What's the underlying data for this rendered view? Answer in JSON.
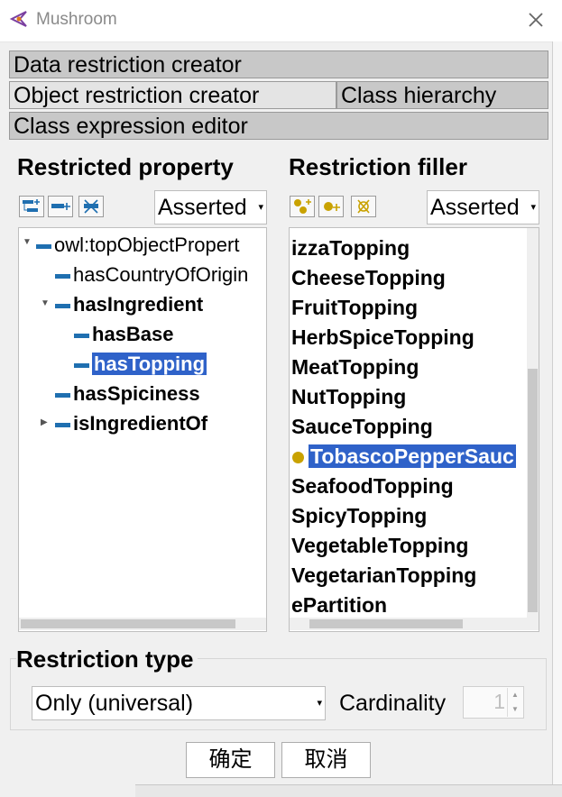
{
  "window": {
    "title": "Mushroom"
  },
  "tabs": {
    "data_restriction": "Data restriction creator",
    "object_restriction": "Object restriction creator",
    "class_hierarchy": "Class hierarchy",
    "class_expression": "Class expression editor"
  },
  "restricted_property": {
    "title": "Restricted property",
    "mode": "Asserted",
    "toolbar_icons": [
      "add-subproperty-icon",
      "add-sibling-property-icon",
      "delete-property-icon"
    ],
    "items": [
      {
        "label": "owl:topObjectPropert",
        "bold": false,
        "selected": false
      },
      {
        "label": "hasCountryOfOrigin",
        "bold": false,
        "selected": false
      },
      {
        "label": "hasIngredient",
        "bold": true,
        "selected": false
      },
      {
        "label": "hasBase",
        "bold": true,
        "selected": false
      },
      {
        "label": "hasTopping",
        "bold": true,
        "selected": true
      },
      {
        "label": "hasSpiciness",
        "bold": true,
        "selected": false
      },
      {
        "label": "isIngredientOf",
        "bold": true,
        "selected": false
      }
    ]
  },
  "restriction_filler": {
    "title": "Restriction filler",
    "mode": "Asserted",
    "toolbar_icons": [
      "add-subclass-icon",
      "add-sibling-class-icon",
      "delete-class-icon"
    ],
    "items": [
      {
        "label": "izzaTopping",
        "selected": false
      },
      {
        "label": "CheeseTopping",
        "selected": false
      },
      {
        "label": "FruitTopping",
        "selected": false
      },
      {
        "label": "HerbSpiceTopping",
        "selected": false
      },
      {
        "label": "MeatTopping",
        "selected": false
      },
      {
        "label": "NutTopping",
        "selected": false
      },
      {
        "label": "SauceTopping",
        "selected": false
      },
      {
        "label": "TobascoPepperSauc",
        "selected": true
      },
      {
        "label": "SeafoodTopping",
        "selected": false
      },
      {
        "label": "SpicyTopping",
        "selected": false
      },
      {
        "label": "VegetableTopping",
        "selected": false
      },
      {
        "label": "VegetarianTopping",
        "selected": false
      },
      {
        "label": "ePartition",
        "selected": false
      }
    ]
  },
  "restriction_type": {
    "title": "Restriction type",
    "selected": "Only (universal)",
    "cardinality_label": "Cardinality",
    "cardinality_value": "1"
  },
  "buttons": {
    "ok": "确定",
    "cancel": "取消"
  },
  "colors": {
    "selection": "#2f62c9",
    "property_icon": "#1f6fb0",
    "individual_dot": "#c9a200"
  }
}
